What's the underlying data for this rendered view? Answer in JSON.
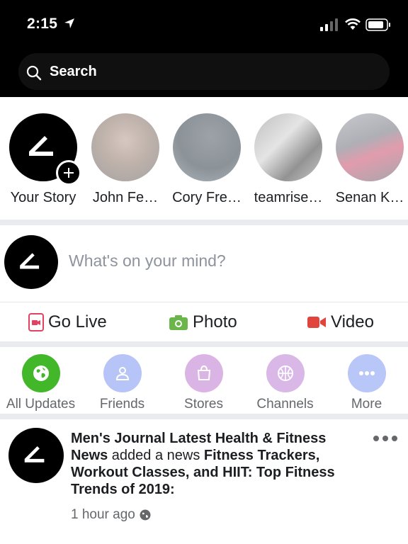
{
  "status_bar": {
    "time": "2:15"
  },
  "search": {
    "label": "Search"
  },
  "stories": [
    {
      "name": "Your Story"
    },
    {
      "name": "John Fe…"
    },
    {
      "name": "Cory Fre…"
    },
    {
      "name": "teamrise…"
    },
    {
      "name": "Senan K…"
    }
  ],
  "composer": {
    "prompt": "What's on your mind?"
  },
  "actions": {
    "live": "Go Live",
    "photo": "Photo",
    "video": "Video"
  },
  "shortcuts": [
    {
      "label": "All Updates",
      "color": "#42b72a"
    },
    {
      "label": "Friends",
      "color": "#b7c4f7"
    },
    {
      "label": "Stores",
      "color": "#dbb4e6"
    },
    {
      "label": "Channels",
      "color": "#d9b8e8"
    },
    {
      "label": "More",
      "color": "#b9c7f8"
    }
  ],
  "post": {
    "author": "Men's Journal Latest Health & Fitness News",
    "verb": " added a news ",
    "headline": "Fitness Trackers, Workout Classes, and HIIT: Top Fitness Trends of 2019:",
    "time": "1 hour ago"
  },
  "colors": {
    "header_bg": "#000000",
    "live": "#e4405f",
    "photo": "#6bb64a",
    "video": "#e0443a"
  }
}
